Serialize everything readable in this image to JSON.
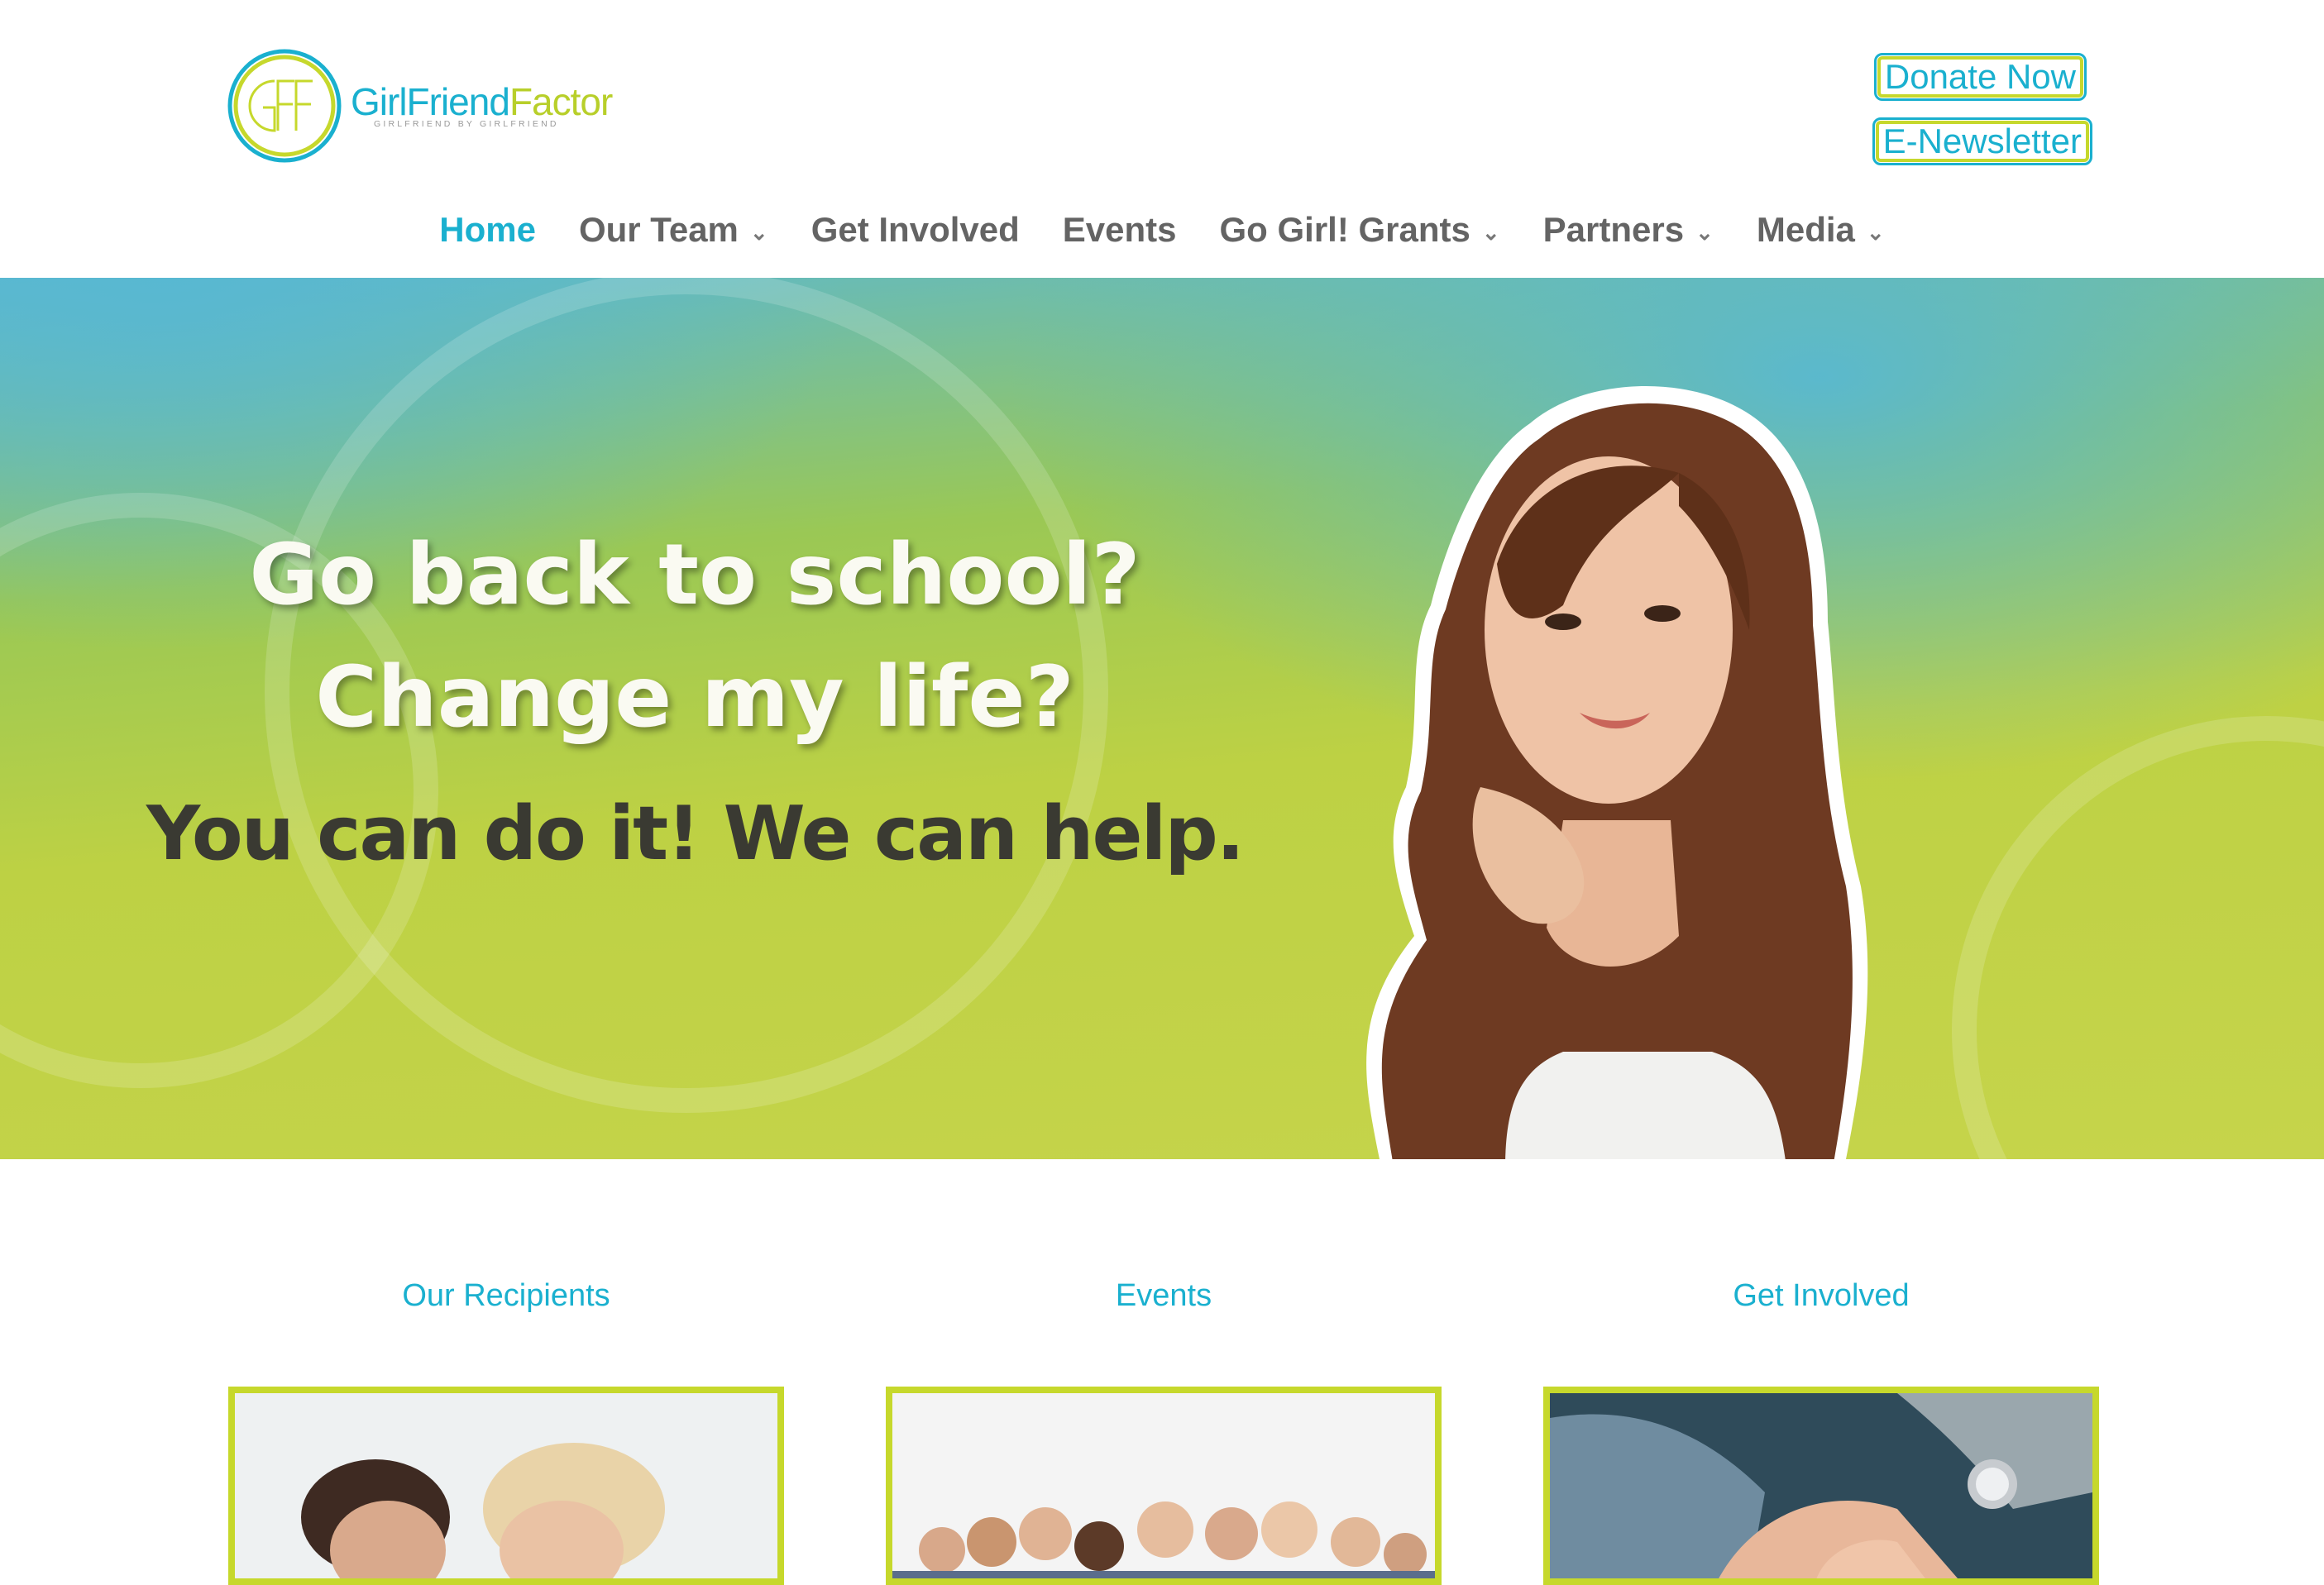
{
  "logo": {
    "word_part1": "GirlFriend",
    "word_part2": "Factor",
    "tagline": "GIRLFRIEND BY GIRLFRIEND",
    "mark_text": "GFF"
  },
  "header": {
    "donate_label": "Donate Now",
    "newsletter_label": "E-Newsletter"
  },
  "nav": {
    "items": [
      {
        "label": "Home",
        "active": true,
        "dropdown": false
      },
      {
        "label": "Our Team",
        "active": false,
        "dropdown": true
      },
      {
        "label": "Get Involved",
        "active": false,
        "dropdown": false
      },
      {
        "label": "Events",
        "active": false,
        "dropdown": false
      },
      {
        "label": "Go Girl! Grants",
        "active": false,
        "dropdown": true
      },
      {
        "label": "Partners",
        "active": false,
        "dropdown": true
      },
      {
        "label": "Media",
        "active": false,
        "dropdown": true
      }
    ]
  },
  "hero": {
    "line1": "Go back to school?",
    "line2": "Change my life?",
    "line3": "You can do it!  We can help."
  },
  "features": [
    {
      "title": "Our Recipients"
    },
    {
      "title": "Events"
    },
    {
      "title": "Get Involved"
    }
  ],
  "colors": {
    "brand_blue": "#1ab0cf",
    "brand_green": "#c6d82c",
    "nav_gray": "#646464"
  }
}
